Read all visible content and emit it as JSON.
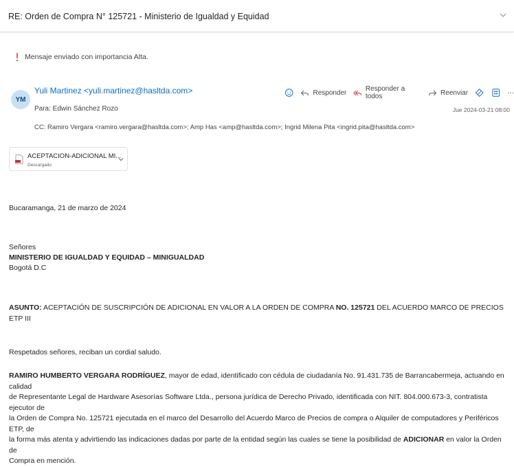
{
  "header": {
    "subject": "RE: Orden de Compra N° 125721 - Ministerio de Igualdad y Equidad"
  },
  "importance_notice": "Mensaje enviado con importancia Alta.",
  "message": {
    "avatar_initials": "YM",
    "sender": "Yuli Martinez <yuli.martinez@hasltda.com>",
    "to": "Para: Edwin Sánchez Rozo",
    "cc": "CC: Ramiro Vergara <ramiro.vergara@hasltda.com>; Amp Has <amp@hasltda.com>; Ingrid Milena Pita <ingrid.pita@hasltda.com>",
    "date": "Jue 2024-03-21 08:00",
    "actions": {
      "reply": "Responder",
      "reply_all": "Responder a todos",
      "forward": "Reenviar",
      "more": "···"
    }
  },
  "attachment": {
    "name": "ACEPTACION-ADICIONAL MI...",
    "status": "Descargado"
  },
  "body": {
    "place_date": "Bucaramanga, 21 de marzo de 2024",
    "salutation": "Señores",
    "recipient_org": "MINISTERIO DE IGUALDAD Y EQUIDAD – MINIGUALDAD",
    "recipient_city": "Bogotá D.C",
    "subject_label": "ASUNTO:",
    "subject_text_1": " ACEPTACIÓN DE SUSCRIPCIÓN DE ADICIONAL EN VALOR A LA ORDEN DE COMPRA ",
    "subject_number": "NO. 125721",
    "subject_text_2": " DEL ACUERDO MARCO DE PRECIOS ETP III",
    "greeting": "Respetados señores, reciban un cordial saludo.",
    "para_name": "RAMIRO HUMBERTO VERGARA RODRÍGUEZ",
    "para_line_1": ", mayor de edad, identificado con cédula de ciudadanía No. 91.431.735 de Barrancabermeja, actuando en calidad",
    "para_line_2": "de Representante Legal de Hardware Asesorías Software Ltda., persona jurídica de Derecho Privado, identificada con NIT. 804.000.673-3, contratista ejecutor de",
    "para_line_3": "la Orden de Compra No. 125721 ejecutada en el marco del Desarrollo del Acuerdo Marco de Precios de compra o Alquiler de computadores y Periféricos ETP, de",
    "para_line_4a": "la forma más atenta y advirtiendo las indicaciones dadas por parte de la entidad según las cuales se tiene la posibilidad de ",
    "para_line_4b": "ADICIONAR",
    "para_line_4c": " en valor la Orden de",
    "para_line_5": "Compra en mención."
  }
}
